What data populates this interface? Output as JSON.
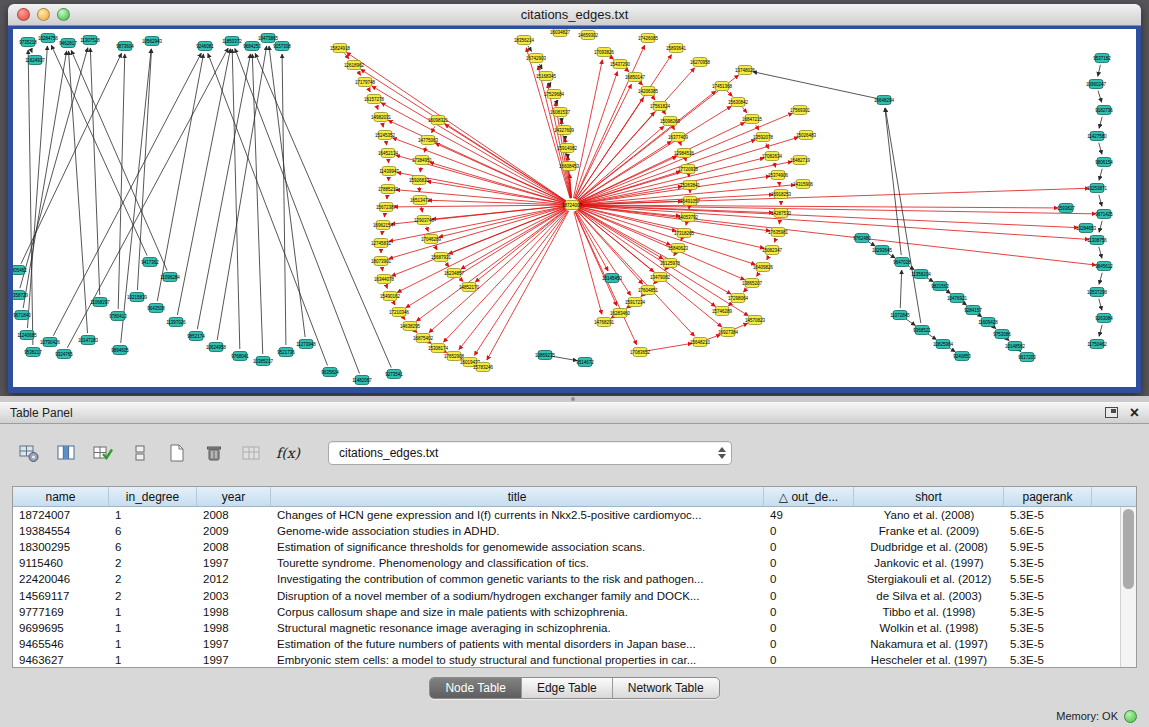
{
  "window": {
    "title": "citations_edges.txt"
  },
  "graph": {
    "frame_color": "#2d4f9e",
    "canvas_bg": "#ffffff",
    "node": {
      "w": 14,
      "h": 9,
      "rx": 2.5,
      "font_size": 4.5,
      "fill_y": "#f4ea43",
      "stroke_y": "#8f8f23",
      "fill_t": "#30bfb0",
      "stroke_t": "#10685d",
      "label_color": "#000000"
    },
    "edge": {
      "red": "#dd1111",
      "black": "#2b2b2b",
      "width": 0.8
    },
    "hub": 0,
    "nodes": [
      [
        559,
        176,
        "y",
        "18724007"
      ],
      [
        327,
        19,
        "y",
        "15824918"
      ],
      [
        341,
        36,
        "y",
        "12618962"
      ],
      [
        352,
        53,
        "y",
        "17179748"
      ],
      [
        361,
        70,
        "y",
        "16157278"
      ],
      [
        368,
        88,
        "y",
        "14982031"
      ],
      [
        372,
        106,
        "y",
        "15245352"
      ],
      [
        375,
        124,
        "y",
        "16452134"
      ],
      [
        376,
        142,
        "y",
        "11439947"
      ],
      [
        375,
        160,
        "y",
        "17885210"
      ],
      [
        373,
        178,
        "y",
        "15672387"
      ],
      [
        370,
        196,
        "y",
        "16962154"
      ],
      [
        368,
        214,
        "y",
        "12745831"
      ],
      [
        368,
        232,
        "y",
        "18073901"
      ],
      [
        371,
        250,
        "y",
        "16344078"
      ],
      [
        377,
        267,
        "y",
        "15490162"
      ],
      [
        386,
        283,
        "y",
        "17210346"
      ],
      [
        397,
        297,
        "y",
        "14638295"
      ],
      [
        410,
        309,
        "y",
        "16875402"
      ],
      [
        425,
        319,
        "y",
        "15308174"
      ],
      [
        441,
        327,
        "y",
        "17652908"
      ],
      [
        457,
        333,
        "y",
        "16019437"
      ],
      [
        470,
        338,
        "y",
        "15783246"
      ],
      [
        425,
        91,
        "y",
        "16098321"
      ],
      [
        415,
        111,
        "y",
        "14775063"
      ],
      [
        409,
        131,
        "y",
        "17384951"
      ],
      [
        406,
        151,
        "y",
        "15926810"
      ],
      [
        407,
        171,
        "y",
        "16513472"
      ],
      [
        411,
        191,
        "y",
        "12903746"
      ],
      [
        418,
        210,
        "y",
        "17046289"
      ],
      [
        428,
        228,
        "y",
        "15687931"
      ],
      [
        441,
        244,
        "y",
        "16234857"
      ],
      [
        456,
        258,
        "y",
        "14852170"
      ],
      [
        511,
        11,
        "y",
        "18356214"
      ],
      [
        523,
        29,
        "y",
        "16742903"
      ],
      [
        533,
        47,
        "y",
        "15168345"
      ],
      [
        541,
        65,
        "y",
        "17529684"
      ],
      [
        547,
        83,
        "y",
        "16081537"
      ],
      [
        551,
        101,
        "y",
        "14327609"
      ],
      [
        554,
        119,
        "y",
        "15914082"
      ],
      [
        556,
        137,
        "y",
        "16608453"
      ],
      [
        591,
        23,
        "y",
        "17093826"
      ],
      [
        607,
        35,
        "y",
        "15437290"
      ],
      [
        622,
        48,
        "y",
        "16850147"
      ],
      [
        635,
        62,
        "y",
        "14206385"
      ],
      [
        647,
        77,
        "y",
        "17561824"
      ],
      [
        657,
        92,
        "y",
        "15098263"
      ],
      [
        665,
        108,
        "y",
        "16377409"
      ],
      [
        671,
        124,
        "y",
        "12984516"
      ],
      [
        675,
        140,
        "y",
        "17720938"
      ],
      [
        677,
        156,
        "y",
        "15263841"
      ],
      [
        677,
        172,
        "y",
        "16491057"
      ],
      [
        675,
        188,
        "y",
        "14053792"
      ],
      [
        671,
        204,
        "y",
        "17318265"
      ],
      [
        665,
        219,
        "y",
        "15840623"
      ],
      [
        657,
        234,
        "y",
        "16125978"
      ],
      [
        647,
        248,
        "y",
        "13479082"
      ],
      [
        635,
        261,
        "y",
        "17604851"
      ],
      [
        622,
        273,
        "y",
        "15917234"
      ],
      [
        607,
        284,
        "y",
        "16283460"
      ],
      [
        591,
        293,
        "y",
        "14768291"
      ],
      [
        709,
        57,
        "y",
        "17451368"
      ],
      [
        725,
        73,
        "y",
        "15630842"
      ],
      [
        739,
        90,
        "y",
        "16847215"
      ],
      [
        750,
        108,
        "y",
        "13592078"
      ],
      [
        759,
        127,
        "y",
        "17082634"
      ],
      [
        765,
        146,
        "y",
        "15374906"
      ],
      [
        768,
        165,
        "y",
        "16918253"
      ],
      [
        768,
        184,
        "y",
        "14287530"
      ],
      [
        765,
        203,
        "y",
        "17635981"
      ],
      [
        759,
        221,
        "y",
        "15082347"
      ],
      [
        750,
        238,
        "y",
        "16409826"
      ],
      [
        739,
        254,
        "y",
        "13865207"
      ],
      [
        725,
        269,
        "y",
        "17298064"
      ],
      [
        709,
        282,
        "y",
        "15746289"
      ],
      [
        547,
        3,
        "y",
        "16034827"
      ],
      [
        575,
        6,
        "y",
        "14659302"
      ],
      [
        635,
        9,
        "y",
        "17426085"
      ],
      [
        663,
        19,
        "y",
        "15893641"
      ],
      [
        687,
        33,
        "y",
        "16270958"
      ],
      [
        732,
        41,
        "y",
        "13748026"
      ],
      [
        787,
        81,
        "y",
        "17569301"
      ],
      [
        793,
        106,
        "y",
        "15026483"
      ],
      [
        787,
        131,
        "y",
        "16482719"
      ],
      [
        790,
        155,
        "y",
        "14315906"
      ],
      [
        627,
        323,
        "y",
        "17083652"
      ],
      [
        687,
        313,
        "y",
        "15648210"
      ],
      [
        715,
        303,
        "y",
        "16927384"
      ],
      [
        742,
        291,
        "y",
        "14570823"
      ],
      [
        15,
        13,
        "t",
        "9735218"
      ],
      [
        35,
        9,
        "t",
        "10284756"
      ],
      [
        55,
        14,
        "t",
        "9462817"
      ],
      [
        77,
        11,
        "t",
        "11307528"
      ],
      [
        112,
        17,
        "t",
        "9873604"
      ],
      [
        139,
        12,
        "t",
        "10562943"
      ],
      [
        192,
        17,
        "t",
        "9246081"
      ],
      [
        219,
        12,
        "t",
        "11850372"
      ],
      [
        239,
        17,
        "t",
        "9684253"
      ],
      [
        255,
        9,
        "t",
        "10473865"
      ],
      [
        269,
        17,
        "t",
        "9157308"
      ],
      [
        22,
        31,
        "t",
        "11624937"
      ],
      [
        5,
        241,
        "t",
        "9805462"
      ],
      [
        5,
        266,
        "t",
        "10358729"
      ],
      [
        9,
        286,
        "t",
        "9671840"
      ],
      [
        14,
        306,
        "t",
        "11240685"
      ],
      [
        20,
        323,
        "t",
        "9538217"
      ],
      [
        37,
        313,
        "t",
        "10790426"
      ],
      [
        51,
        325,
        "t",
        "9324765"
      ],
      [
        87,
        273,
        "t",
        "11068297"
      ],
      [
        105,
        287,
        "t",
        "9780413"
      ],
      [
        124,
        268,
        "t",
        "10215839"
      ],
      [
        143,
        279,
        "t",
        "9643508"
      ],
      [
        163,
        293,
        "t",
        "11397026"
      ],
      [
        183,
        307,
        "t",
        "9852174"
      ],
      [
        203,
        318,
        "t",
        "10624958"
      ],
      [
        137,
        233,
        "t",
        "9417362"
      ],
      [
        157,
        248,
        "t",
        "11096284"
      ],
      [
        227,
        327,
        "t",
        "9768041"
      ],
      [
        250,
        332,
        "t",
        "10385217"
      ],
      [
        273,
        323,
        "t",
        "9521736"
      ],
      [
        293,
        315,
        "t",
        "11273948"
      ],
      [
        107,
        321,
        "t",
        "9894605"
      ],
      [
        75,
        311,
        "t",
        "10147283"
      ],
      [
        317,
        343,
        "t",
        "9635824"
      ],
      [
        349,
        351,
        "t",
        "11482067"
      ],
      [
        381,
        345,
        "t",
        "9273541"
      ],
      [
        532,
        326,
        "t",
        "10869235"
      ],
      [
        572,
        333,
        "t",
        "9514672"
      ],
      [
        599,
        249,
        "t",
        "15145453"
      ],
      [
        849,
        209,
        "t",
        "9762480"
      ],
      [
        869,
        221,
        "t",
        "10293645"
      ],
      [
        889,
        233,
        "t",
        "9647028"
      ],
      [
        908,
        245,
        "t",
        "11358204"
      ],
      [
        927,
        257,
        "t",
        "9821563"
      ],
      [
        944,
        269,
        "t",
        "10476921"
      ],
      [
        960,
        281,
        "t",
        "9284157"
      ],
      [
        975,
        293,
        "t",
        "11609428"
      ],
      [
        989,
        305,
        "t",
        "9753086"
      ],
      [
        1002,
        317,
        "t",
        "10148562"
      ],
      [
        1014,
        328,
        "t",
        "9617203"
      ],
      [
        887,
        286,
        "t",
        "11072845"
      ],
      [
        909,
        301,
        "t",
        "9368521"
      ],
      [
        930,
        315,
        "t",
        "10825964"
      ],
      [
        949,
        327,
        "t",
        "9240853"
      ],
      [
        871,
        71,
        "t",
        "16648294"
      ],
      [
        1089,
        29,
        "t",
        "9537182"
      ],
      [
        1083,
        55,
        "t",
        "10960247"
      ],
      [
        1091,
        81,
        "t",
        "9182736"
      ],
      [
        1084,
        107,
        "t",
        "11427580"
      ],
      [
        1091,
        133,
        "t",
        "9806154"
      ],
      [
        1084,
        159,
        "t",
        "10253871"
      ],
      [
        1091,
        185,
        "t",
        "9671425"
      ],
      [
        1084,
        211,
        "t",
        "11308756"
      ],
      [
        1091,
        237,
        "t",
        "9845612"
      ],
      [
        1084,
        263,
        "t",
        "10537298"
      ],
      [
        1091,
        289,
        "t",
        "9263084"
      ],
      [
        1084,
        315,
        "t",
        "11750462"
      ],
      [
        1053,
        179,
        "t",
        "1593827"
      ],
      [
        1073,
        199,
        "t",
        "10284653"
      ]
    ],
    "spoke_ranges": [
      [
        1,
        74
      ],
      [
        77,
        88
      ]
    ],
    "spoke_extras": [
      128,
      150,
      151,
      152,
      153,
      157,
      158
    ],
    "chains": [
      {
        "range": [
          1,
          22
        ],
        "color": "red"
      },
      {
        "range": [
          23,
          32
        ],
        "color": "red"
      },
      {
        "range": [
          33,
          40
        ],
        "color": "black"
      },
      {
        "range": [
          41,
          60
        ],
        "color": "red"
      },
      {
        "range": [
          61,
          74
        ],
        "color": "red"
      },
      {
        "range": [
          85,
          88
        ],
        "color": "red"
      },
      {
        "range": [
          129,
          139
        ],
        "color": "black"
      },
      {
        "range": [
          140,
          143
        ],
        "color": "black"
      },
      {
        "range": [
          145,
          156
        ],
        "color": "black"
      }
    ],
    "black_edges": [
      [
        105,
        89
      ],
      [
        104,
        90
      ],
      [
        103,
        91
      ],
      [
        102,
        92
      ],
      [
        101,
        93
      ],
      [
        108,
        92
      ],
      [
        109,
        93
      ],
      [
        110,
        94
      ],
      [
        111,
        95
      ],
      [
        112,
        96
      ],
      [
        113,
        97
      ],
      [
        114,
        98
      ],
      [
        115,
        90
      ],
      [
        116,
        91
      ],
      [
        121,
        94
      ],
      [
        122,
        91
      ],
      [
        106,
        95
      ],
      [
        107,
        96
      ],
      [
        117,
        96
      ],
      [
        118,
        97
      ],
      [
        119,
        99
      ],
      [
        120,
        98
      ],
      [
        123,
        95
      ],
      [
        124,
        96
      ],
      [
        125,
        97
      ],
      [
        126,
        127
      ],
      [
        131,
        144
      ],
      [
        141,
        144
      ],
      [
        144,
        80
      ],
      [
        89,
        100
      ],
      [
        140,
        131
      ]
    ]
  },
  "table_panel": {
    "title": "Table Panel",
    "toolbar": {
      "icons": [
        "table-mode",
        "show-columns",
        "select-rows",
        "row-tools",
        "new-column",
        "delete-column",
        "import-table",
        "function-builder"
      ],
      "network_select": "citations_edges.txt"
    },
    "table": {
      "columns": [
        {
          "label": "name"
        },
        {
          "label": "in_degree"
        },
        {
          "label": "year"
        },
        {
          "label": "title"
        },
        {
          "label": "out_de...",
          "sort": "△"
        },
        {
          "label": "short"
        },
        {
          "label": "pagerank"
        }
      ],
      "rows": [
        [
          "18724007",
          "1",
          "2008",
          "Changes of HCN gene expression and I(f) currents in Nkx2.5-positive cardiomyoc...",
          "49",
          "Yano et al. (2008)",
          "5.3E-5"
        ],
        [
          "19384554",
          "6",
          "2009",
          "Genome-wide association studies in ADHD.",
          "0",
          "Franke et al. (2009)",
          "5.6E-5"
        ],
        [
          "18300295",
          "6",
          "2008",
          "Estimation of significance thresholds for genomewide association scans.",
          "0",
          "Dudbridge et al. (2008)",
          "5.9E-5"
        ],
        [
          "9115460",
          "2",
          "1997",
          "Tourette syndrome. Phenomenology and classification of tics.",
          "0",
          "Jankovic et al. (1997)",
          "5.3E-5"
        ],
        [
          "22420046",
          "2",
          "2012",
          "Investigating the contribution of common genetic variants to the risk and pathogen...",
          "0",
          "Stergiakouli et al. (2012)",
          "5.5E-5"
        ],
        [
          "14569117",
          "2",
          "2003",
          "Disruption of a novel member of a sodium/hydrogen exchanger family and DOCK...",
          "0",
          "de Silva et al. (2003)",
          "5.3E-5"
        ],
        [
          "9777169",
          "1",
          "1998",
          "Corpus callosum shape and size in male patients with schizophrenia.",
          "0",
          "Tibbo et al. (1998)",
          "5.3E-5"
        ],
        [
          "9699695",
          "1",
          "1998",
          "Structural magnetic resonance image averaging in schizophrenia.",
          "0",
          "Wolkin et al. (1998)",
          "5.3E-5"
        ],
        [
          "9465546",
          "1",
          "1997",
          "Estimation of the future numbers of patients with mental disorders in Japan base...",
          "0",
          "Nakamura et al. (1997)",
          "5.3E-5"
        ],
        [
          "9463627",
          "1",
          "1997",
          "Embryonic stem cells: a model to study structural and functional properties in car...",
          "0",
          "Hescheler et al. (1997)",
          "5.3E-5"
        ]
      ]
    },
    "tabs": [
      {
        "label": "Node Table",
        "active": true
      },
      {
        "label": "Edge Table",
        "active": false
      },
      {
        "label": "Network Table",
        "active": false
      }
    ],
    "status": {
      "memory_label": "Memory: OK",
      "status_color": "#3ec43e"
    }
  }
}
